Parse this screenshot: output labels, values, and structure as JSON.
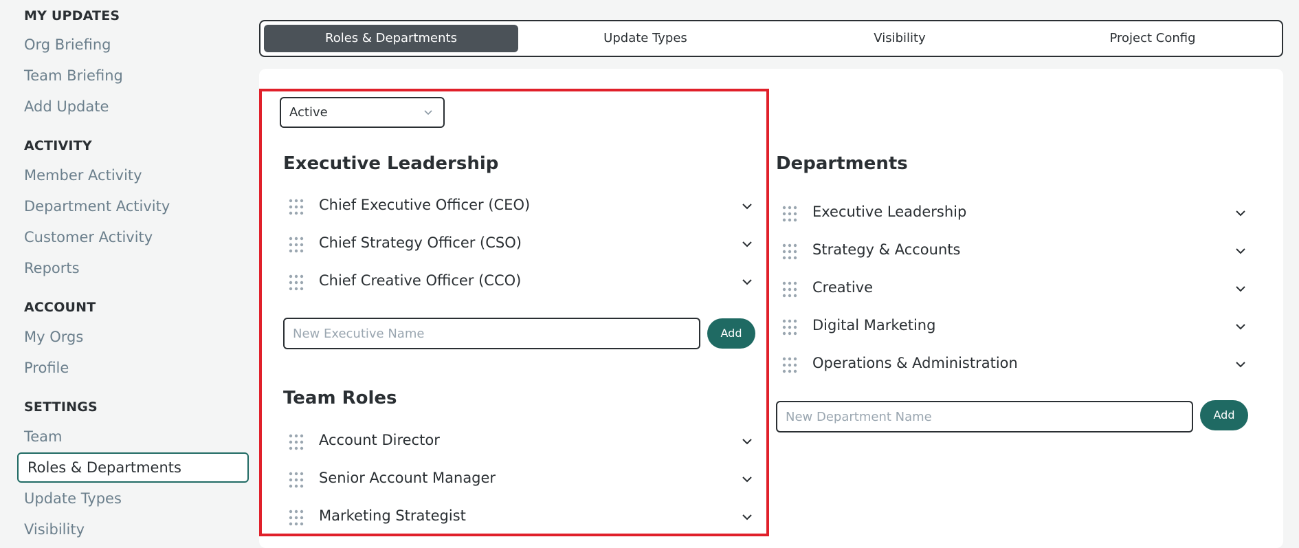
{
  "sidebar": {
    "sections": [
      {
        "heading": "MY UPDATES",
        "items": [
          "Org Briefing",
          "Team Briefing",
          "Add Update"
        ]
      },
      {
        "heading": "ACTIVITY",
        "items": [
          "Member Activity",
          "Department Activity",
          "Customer Activity",
          "Reports"
        ]
      },
      {
        "heading": "ACCOUNT",
        "items": [
          "My Orgs",
          "Profile"
        ]
      },
      {
        "heading": "SETTINGS",
        "items": [
          "Team",
          "Roles & Departments",
          "Update Types",
          "Visibility"
        ]
      }
    ],
    "active_item": "Roles & Departments"
  },
  "tabs": [
    {
      "label": "Roles & Departments",
      "active": true
    },
    {
      "label": "Update Types",
      "active": false
    },
    {
      "label": "Visibility",
      "active": false
    },
    {
      "label": "Project Config",
      "active": false
    }
  ],
  "status_filter": {
    "value": "Active"
  },
  "executive_leadership": {
    "title": "Executive Leadership",
    "items": [
      "Chief Executive Officer (CEO)",
      "Chief Strategy Officer (CSO)",
      "Chief Creative Officer (CCO)"
    ],
    "input_placeholder": "New Executive Name",
    "add_label": "Add"
  },
  "team_roles": {
    "title": "Team Roles",
    "items": [
      "Account Director",
      "Senior Account Manager",
      "Marketing Strategist"
    ]
  },
  "departments": {
    "title": "Departments",
    "items": [
      "Executive Leadership",
      "Strategy & Accounts",
      "Creative",
      "Digital Marketing",
      "Operations & Administration"
    ],
    "input_placeholder": "New Department Name",
    "add_label": "Add"
  },
  "colors": {
    "accent": "#1f6a63",
    "active_tab": "#4b5258",
    "highlight": "#e0202a",
    "muted_text": "#6b7f8c"
  }
}
